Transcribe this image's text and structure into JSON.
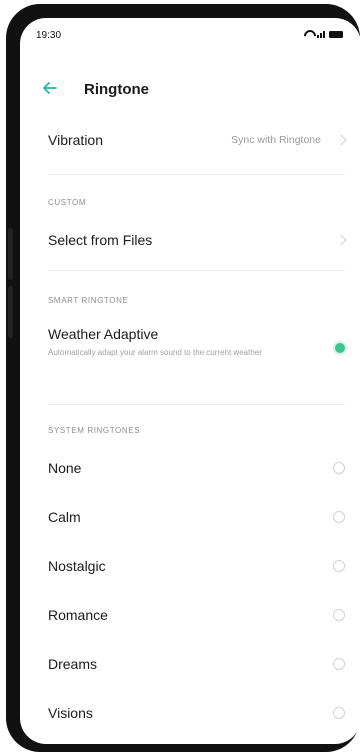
{
  "status_bar": {
    "time": "19:30"
  },
  "header": {
    "title": "Ringtone"
  },
  "vibration": {
    "label": "Vibration",
    "value": "Sync with Ringtone"
  },
  "custom": {
    "section_title": "CUSTOM",
    "select_files_label": "Select from Files"
  },
  "smart": {
    "section_title": "SMART RINGTONE",
    "weather_label": "Weather Adaptive",
    "weather_desc": "Automatically adapt your alarm sound to the current weather",
    "weather_enabled": true
  },
  "system": {
    "section_title": "SYSTEM RINGTONES",
    "items": [
      "None",
      "Calm",
      "Nostalgic",
      "Romance",
      "Dreams",
      "Visions"
    ]
  },
  "colors": {
    "accent": "#2bb59a",
    "toggle": "#3cc48c"
  },
  "icons": [
    "back-arrow-icon",
    "wifi-icon",
    "signal-icon",
    "battery-icon",
    "chevron-right-icon"
  ]
}
